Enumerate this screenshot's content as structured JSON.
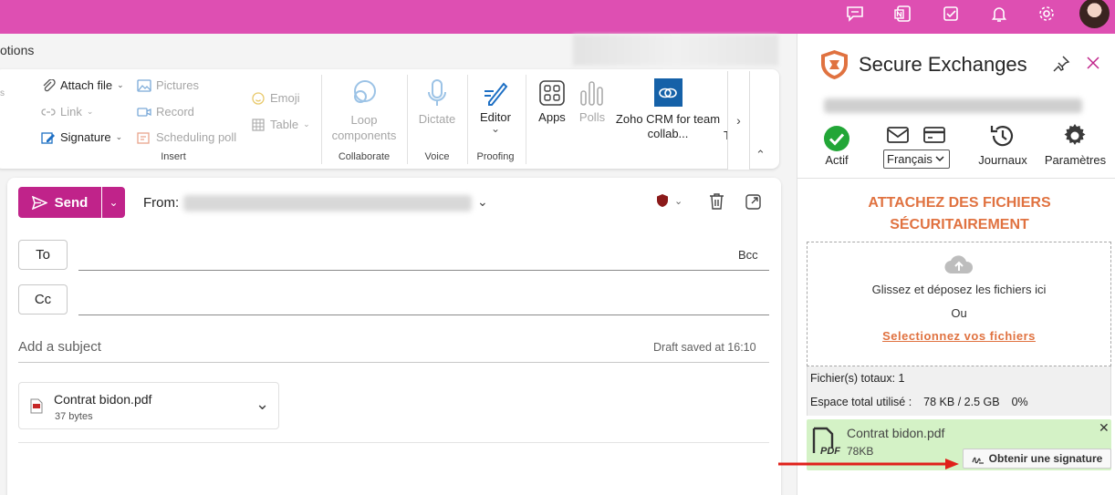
{
  "colors": {
    "topbar": "#de4fb2",
    "send": "#c0238a",
    "accent_orange": "#e07240",
    "file_card_bg": "#d4f2c6"
  },
  "top_icons": [
    "chat-icon",
    "onenote-icon",
    "tasks-icon",
    "bell-icon",
    "gear-icon"
  ],
  "header": {
    "options_fragment": "otions"
  },
  "ribbon": {
    "insert": {
      "attach_file": "Attach file",
      "link": "Link",
      "signature": "Signature",
      "pictures": "Pictures",
      "record": "Record",
      "scheduling_poll": "Scheduling poll",
      "emoji": "Emoji",
      "table": "Table",
      "group_label": "Insert"
    },
    "collaborate": {
      "loop_line1": "Loop",
      "loop_line2": "components",
      "group_label": "Collaborate"
    },
    "voice": {
      "dictate": "Dictate",
      "group_label": "Voice"
    },
    "proofing": {
      "editor": "Editor",
      "group_label": "Proofing"
    },
    "apps": {
      "apps": "Apps",
      "polls": "Polls",
      "zoho_line1": "Zoho CRM for team",
      "zoho_line2": "collab...",
      "overflow_fragment": "T"
    }
  },
  "compose": {
    "send": "Send",
    "from_label": "From:",
    "to_label": "To",
    "bcc_label": "Bcc",
    "cc_label": "Cc",
    "subject_placeholder": "Add a subject",
    "draft_status": "Draft saved at 16:10",
    "attachment": {
      "name": "Contrat bidon.pdf",
      "size": "37 bytes"
    }
  },
  "secure_exchanges": {
    "title": "Secure Exchanges",
    "actif": "Actif",
    "language": "Français",
    "journaux": "Journaux",
    "parametres": "Paramètres",
    "heading_line1": "ATTACHEZ DES FICHIERS",
    "heading_line2": "SÉCURITAIREMENT",
    "drop_text": "Glissez et déposez les fichiers ici",
    "or": "Ou",
    "select_link": "Selectionnez vos fichiers",
    "total_files": "Fichier(s) totaux: 1",
    "space_used_label": "Espace total utilisé :",
    "space_used_value": "78 KB / 2.5 GB",
    "space_used_pct": "0%",
    "file": {
      "name": "Contrat bidon.pdf",
      "size": "78KB",
      "type_label": "PDF"
    },
    "signature_button": "Obtenir une signature"
  }
}
